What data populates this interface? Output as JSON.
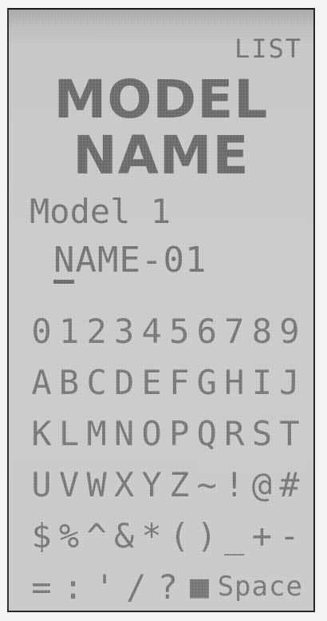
{
  "screen": {
    "list_label": "LIST",
    "title_line1": "MODEL",
    "title_line2": "NAME",
    "model_label": "Model 1",
    "name_value_cursor_char": "N",
    "name_value_rest": "AME-01"
  },
  "char_rows": [
    [
      "0",
      "1",
      "2",
      "3",
      "4",
      "5",
      "6",
      "7",
      "8",
      "9"
    ],
    [
      "A",
      "B",
      "C",
      "D",
      "E",
      "F",
      "G",
      "H",
      "I",
      "J"
    ],
    [
      "K",
      "L",
      "M",
      "N",
      "O",
      "P",
      "Q",
      "R",
      "S",
      "T"
    ],
    [
      "U",
      "V",
      "W",
      "X",
      "Y",
      "Z",
      "~",
      "!",
      "@",
      "#"
    ],
    [
      "$",
      "%",
      "^",
      "&",
      "*",
      "(",
      ")",
      "_",
      "+",
      "-"
    ],
    [
      "=",
      ":",
      "'",
      "/",
      "?",
      "■"
    ]
  ],
  "space_key_label": "Space",
  "colors": {
    "lcd_background": "#c9c9c9",
    "lcd_text": "#6b6b6b",
    "bezel": "#262626"
  }
}
